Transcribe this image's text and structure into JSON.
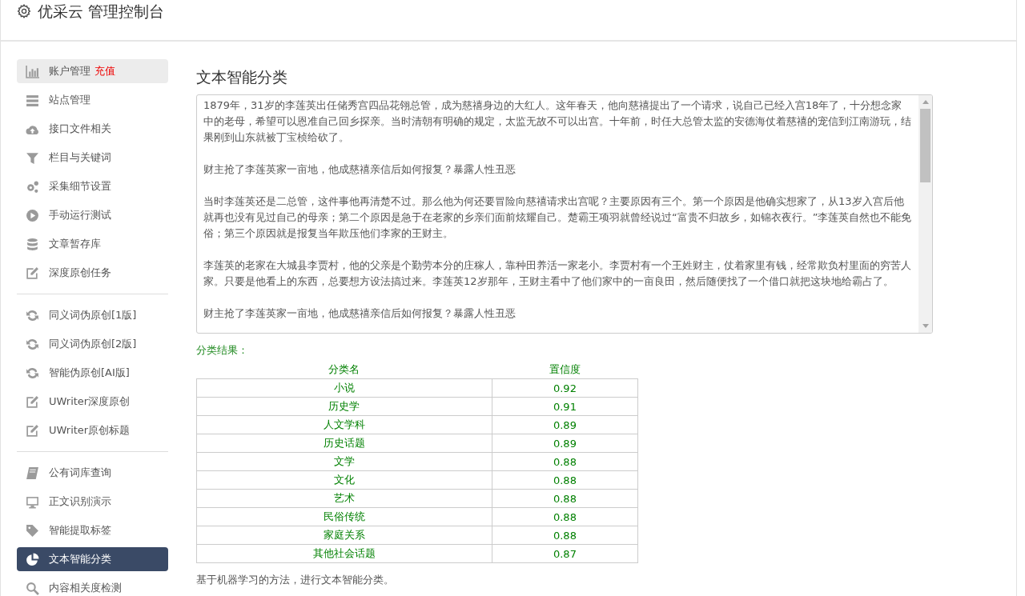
{
  "header": {
    "title": "优采云 管理控制台"
  },
  "sidebar": {
    "groups": [
      {
        "items": [
          {
            "label": "账户管理",
            "badge": "充值",
            "selected": false,
            "hover": true
          },
          {
            "label": "站点管理",
            "selected": false,
            "hover": false
          },
          {
            "label": "接口文件相关",
            "selected": false,
            "hover": false
          },
          {
            "label": "栏目与关键词",
            "selected": false,
            "hover": false
          },
          {
            "label": "采集细节设置",
            "selected": false,
            "hover": false
          },
          {
            "label": "手动运行测试",
            "selected": false,
            "hover": false
          },
          {
            "label": "文章暂存库",
            "selected": false,
            "hover": false
          },
          {
            "label": "深度原创任务",
            "selected": false,
            "hover": false
          }
        ]
      },
      {
        "items": [
          {
            "label": "同义词伪原创[1版]",
            "selected": false,
            "hover": false
          },
          {
            "label": "同义词伪原创[2版]",
            "selected": false,
            "hover": false
          },
          {
            "label": "智能伪原创[AI版]",
            "selected": false,
            "hover": false
          },
          {
            "label": "UWriter深度原创",
            "selected": false,
            "hover": false
          },
          {
            "label": "UWriter原创标题",
            "selected": false,
            "hover": false
          }
        ]
      },
      {
        "items": [
          {
            "label": "公有词库查询",
            "selected": false,
            "hover": false
          },
          {
            "label": "正文识别演示",
            "selected": false,
            "hover": false
          },
          {
            "label": "智能提取标签",
            "selected": false,
            "hover": false
          },
          {
            "label": "文本智能分类",
            "selected": true,
            "hover": false
          },
          {
            "label": "内容相关度检测",
            "selected": false,
            "hover": false
          }
        ]
      }
    ]
  },
  "main": {
    "title": "文本智能分类",
    "text_area": {
      "paragraphs": [
        "1879年，31岁的李莲英出任储秀宫四品花翎总管，成为慈禧身边的大红人。这年春天，他向慈禧提出了一个请求，说自己已经入宫18年了，十分想念家中的老母，希望可以恩准自己回乡探亲。当时清朝有明确的规定，太监无故不可以出宫。十年前，时任大总管太监的安德海仗着慈禧的宠信到江南游玩，结果刚到山东就被丁宝桢给砍了。",
        "财主抢了李莲英家一亩地，他成慈禧亲信后如何报复？暴露人性丑恶",
        "当时李莲英还是二总管，这件事他再清楚不过。那么他为何还要冒险向慈禧请求出宫呢？主要原因有三个。第一个原因是他确实想家了，从13岁入宫后他就再也没有见过自己的母亲；第二个原因是急于在老家的乡亲们面前炫耀自己。楚霸王项羽就曾经说过“富贵不归故乡，如锦衣夜行。”李莲英自然也不能免俗；第三个原因就是报复当年欺压他们李家的王财主。",
        "李莲英的老家在大城县李贾村，他的父亲是个勤劳本分的庄稼人，靠种田养活一家老小。李贾村有一个王姓财主，仗着家里有钱，经常欺负村里面的穷苦人家。只要是他看上的东西，总要想方设法搞过来。李莲英12岁那年，王财主看中了他们家中的一亩良田，然后随便找了一个借口就把这块地给霸占了。",
        "财主抢了李莲英家一亩地，他成慈禧亲信后如何报复？暴露人性丑恶"
      ]
    },
    "result_label": "分类结果：",
    "table": {
      "columns": [
        "分类名",
        "置信度"
      ],
      "rows": [
        [
          "小说",
          "0.92"
        ],
        [
          "历史学",
          "0.91"
        ],
        [
          "人文学科",
          "0.89"
        ],
        [
          "历史话题",
          "0.89"
        ],
        [
          "文学",
          "0.88"
        ],
        [
          "文化",
          "0.88"
        ],
        [
          "艺术",
          "0.88"
        ],
        [
          "民俗传统",
          "0.88"
        ],
        [
          "家庭关系",
          "0.88"
        ],
        [
          "其他社会话题",
          "0.87"
        ]
      ]
    },
    "footnote": "基于机器学习的方法，进行文本智能分类。"
  }
}
